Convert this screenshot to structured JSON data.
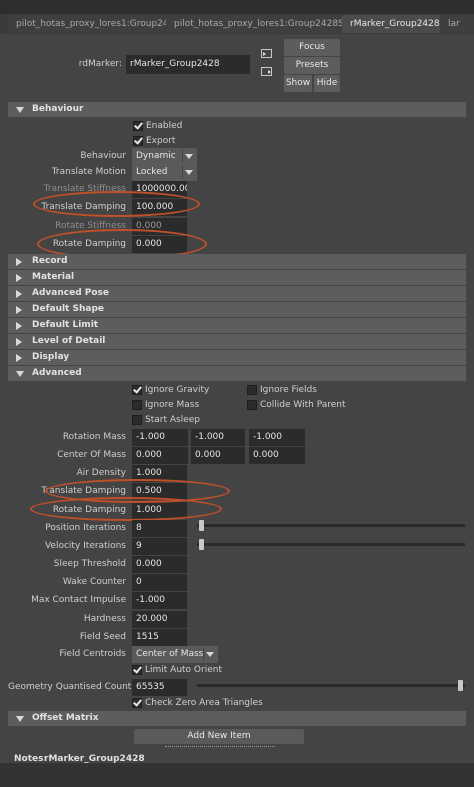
{
  "tabs": [
    {
      "label": "pilot_hotas_proxy_lores1:Group2428"
    },
    {
      "label": "pilot_hotas_proxy_lores1:Group2428Shape"
    },
    {
      "label": "rMarker_Group2428"
    },
    {
      "label": "lar"
    }
  ],
  "header": {
    "node_label": "rdMarker:",
    "node_value": "rMarker_Group2428",
    "focus": "Focus",
    "presets": "Presets",
    "show": "Show",
    "hide": "Hide"
  },
  "behaviour": {
    "title": "Behaviour",
    "enabled_label": "Enabled",
    "export_label": "Export",
    "behaviour_label": "Behaviour",
    "behaviour_value": "Dynamic",
    "translate_motion_label": "Translate Motion",
    "translate_motion_value": "Locked",
    "translate_stiffness_label": "Translate Stiffness",
    "translate_stiffness_value": "1000000.000",
    "translate_damping_label": "Translate Damping",
    "translate_damping_value": "100.000",
    "rotate_stiffness_label": "Rotate Stiffness",
    "rotate_stiffness_value": "0.000",
    "rotate_damping_label": "Rotate Damping",
    "rotate_damping_value": "0.000"
  },
  "collapsed_sections": [
    "Record",
    "Material",
    "Advanced Pose",
    "Default Shape",
    "Default Limit",
    "Level of Detail",
    "Display"
  ],
  "advanced": {
    "title": "Advanced",
    "ignore_gravity": "Ignore Gravity",
    "ignore_fields": "Ignore Fields",
    "ignore_mass": "Ignore Mass",
    "collide_with_parent": "Collide With Parent",
    "start_asleep": "Start Asleep",
    "rotation_mass_label": "Rotation Mass",
    "rotation_mass": [
      "-1.000",
      "-1.000",
      "-1.000"
    ],
    "center_of_mass_label": "Center Of Mass",
    "center_of_mass": [
      "0.000",
      "0.000",
      "0.000"
    ],
    "air_density_label": "Air Density",
    "air_density_value": "1.000",
    "translate_damping_label": "Translate Damping",
    "translate_damping_value": "0.500",
    "rotate_damping_label": "Rotate Damping",
    "rotate_damping_value": "1.000",
    "position_iterations_label": "Position Iterations",
    "position_iterations_value": "8",
    "velocity_iterations_label": "Velocity Iterations",
    "velocity_iterations_value": "9",
    "sleep_threshold_label": "Sleep Threshold",
    "sleep_threshold_value": "0.000",
    "wake_counter_label": "Wake Counter",
    "wake_counter_value": "0",
    "max_contact_impulse_label": "Max Contact Impulse",
    "max_contact_impulse_value": "-1.000",
    "hardness_label": "Hardness",
    "hardness_value": "20.000",
    "field_seed_label": "Field Seed",
    "field_seed_value": "1515",
    "field_centroids_label": "Field Centroids",
    "field_centroids_value": "Center of Mass",
    "limit_auto_orient": "Limit Auto Orient",
    "geometry_quantised_count_label": "Geometry Quantised Count",
    "geometry_quantised_count_value": "65535",
    "check_zero_area": "Check Zero Area Triangles"
  },
  "offset_matrix": {
    "title": "Offset Matrix",
    "add_new_item": "Add New Item"
  },
  "notes": {
    "label": "Notes:",
    "value": "rMarker_Group2428"
  },
  "colors": {
    "annotation": "#c0502a",
    "panel_bg": "#444444",
    "field_bg": "#2b2b2b",
    "section_bg": "#5d5d5d"
  }
}
